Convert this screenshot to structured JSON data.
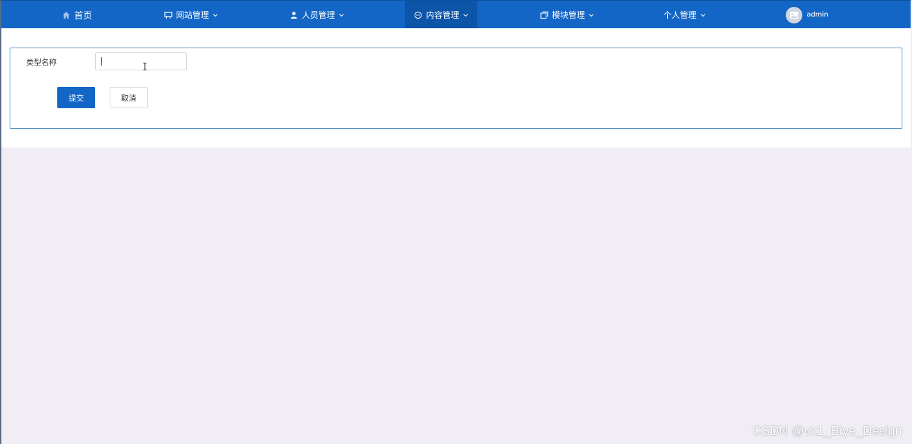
{
  "nav": {
    "items": [
      {
        "label": "首页",
        "icon": "home-icon",
        "has_dropdown": false,
        "active": false
      },
      {
        "label": "网站管理",
        "icon": "website-icon",
        "has_dropdown": true,
        "active": false
      },
      {
        "label": "人员管理",
        "icon": "person-icon",
        "has_dropdown": true,
        "active": false
      },
      {
        "label": "内容管理",
        "icon": "message-icon",
        "has_dropdown": true,
        "active": true
      },
      {
        "label": "模块管理",
        "icon": "module-icon",
        "has_dropdown": true,
        "active": false
      },
      {
        "label": "个人管理",
        "icon": "",
        "has_dropdown": true,
        "active": false
      }
    ],
    "user": {
      "name": "admin",
      "avatar_icon": "avatar-image-icon"
    }
  },
  "form": {
    "field_label": "类型名称",
    "field_value": "",
    "submit_label": "提交",
    "cancel_label": "取消"
  },
  "watermark": "CSDN @vx1_Biye_Design",
  "colors": {
    "nav_bg": "#1366c6",
    "nav_active": "#0c55a8",
    "primary": "#1366c6",
    "page_bg": "#f0eef4",
    "card_border": "#4a8fc7"
  }
}
